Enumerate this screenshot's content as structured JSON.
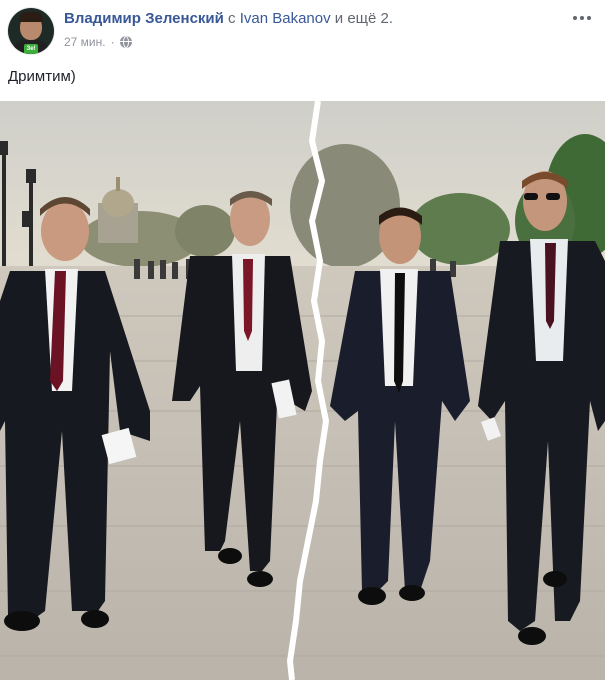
{
  "post": {
    "author": "Владимир Зеленский",
    "with_text": "с",
    "tagged_person": "Ivan Bakanov",
    "and_more": "и ещё 2.",
    "time": "27 мин.",
    "separator": "·",
    "privacy_icon": "globe-icon",
    "more_icon": "more-options-icon",
    "text": "Дримтим)",
    "avatar_badge": "Зе!"
  },
  "colors": {
    "author_link": "#385898",
    "meta": "#90949c",
    "text": "#1d2129",
    "sky": "#d8d6cc",
    "pavement": "#d6d2cb",
    "suit": "#15171c",
    "tear": "#ffffff"
  }
}
